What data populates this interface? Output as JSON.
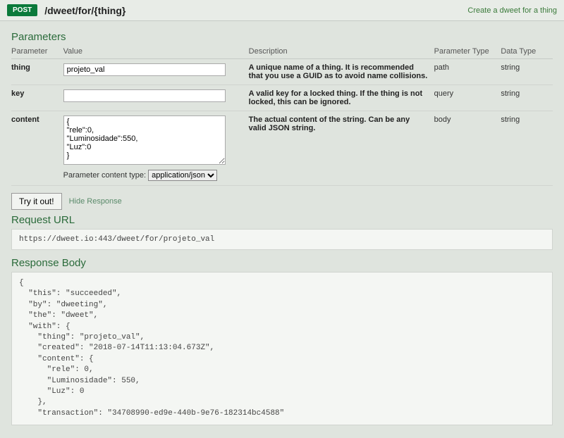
{
  "header": {
    "method": "POST",
    "path": "/dweet/for/{thing}",
    "description": "Create a dweet for a thing"
  },
  "sections": {
    "parameters_heading": "Parameters",
    "request_url_heading": "Request URL",
    "response_body_heading": "Response Body"
  },
  "params_table": {
    "headers": {
      "parameter": "Parameter",
      "value": "Value",
      "description": "Description",
      "parameter_type": "Parameter Type",
      "data_type": "Data Type"
    },
    "rows": [
      {
        "name": "thing",
        "value": "projeto_val",
        "description": "A unique name of a thing. It is recommended that you use a GUID as to avoid name collisions.",
        "param_type": "path",
        "data_type": "string"
      },
      {
        "name": "key",
        "value": "",
        "description": "A valid key for a locked thing. If the thing is not locked, this can be ignored.",
        "param_type": "query",
        "data_type": "string"
      },
      {
        "name": "content",
        "value": "{\n\"rele\":0,\n\"Luminosidade\":550,\n\"Luz\":0\n}",
        "description": "The actual content of the string. Can be any valid JSON string.",
        "param_type": "body",
        "data_type": "string"
      }
    ],
    "content_type_label": "Parameter content type:",
    "content_type_value": "application/json"
  },
  "actions": {
    "try_it_out": "Try it out!",
    "hide_response": "Hide Response"
  },
  "request_url": "https://dweet.io:443/dweet/for/projeto_val",
  "response_body": "{\n  \"this\": \"succeeded\",\n  \"by\": \"dweeting\",\n  \"the\": \"dweet\",\n  \"with\": {\n    \"thing\": \"projeto_val\",\n    \"created\": \"2018-07-14T11:13:04.673Z\",\n    \"content\": {\n      \"rele\": 0,\n      \"Luminosidade\": 550,\n      \"Luz\": 0\n    },\n    \"transaction\": \"34708990-ed9e-440b-9e76-182314bc4588\""
}
